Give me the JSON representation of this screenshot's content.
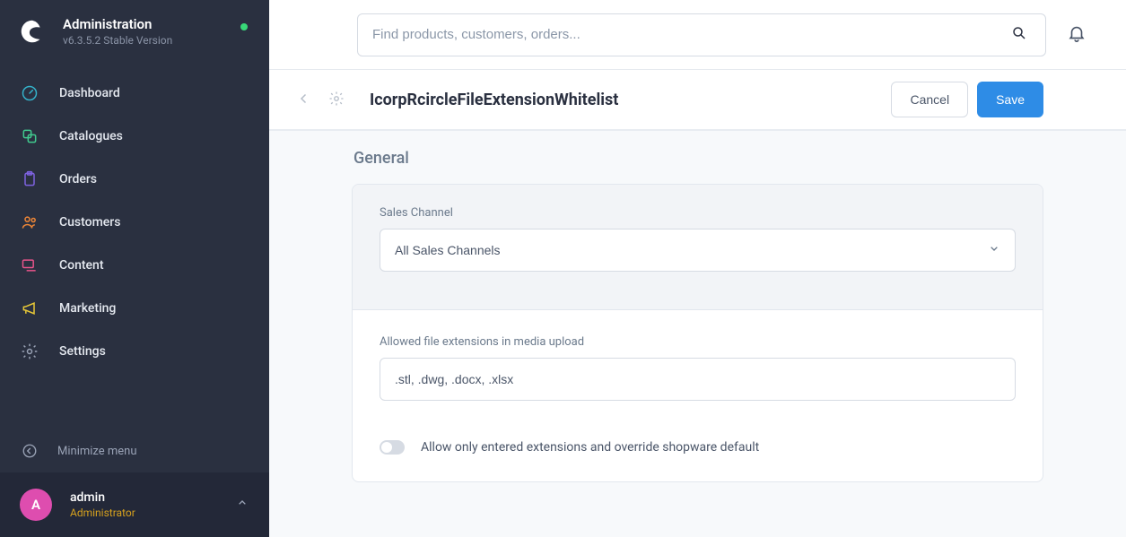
{
  "sidebar": {
    "title": "Administration",
    "subtitle": "v6.3.5.2 Stable Version",
    "items": [
      {
        "label": "Dashboard"
      },
      {
        "label": "Catalogues"
      },
      {
        "label": "Orders"
      },
      {
        "label": "Customers"
      },
      {
        "label": "Content"
      },
      {
        "label": "Marketing"
      },
      {
        "label": "Settings"
      }
    ],
    "minimize_label": "Minimize menu"
  },
  "user": {
    "avatar_letter": "A",
    "name": "admin",
    "role": "Administrator"
  },
  "search": {
    "placeholder": "Find products, customers, orders..."
  },
  "page": {
    "title": "IcorpRcircleFileExtensionWhitelist",
    "cancel_label": "Cancel",
    "save_label": "Save"
  },
  "general": {
    "section_title": "General",
    "sales_channel_label": "Sales Channel",
    "sales_channel_value": "All Sales Channels",
    "allowed_ext_label": "Allowed file extensions in media upload",
    "allowed_ext_value": ".stl, .dwg, .docx, .xlsx",
    "override_toggle_label": "Allow only entered extensions and override shopware default"
  }
}
